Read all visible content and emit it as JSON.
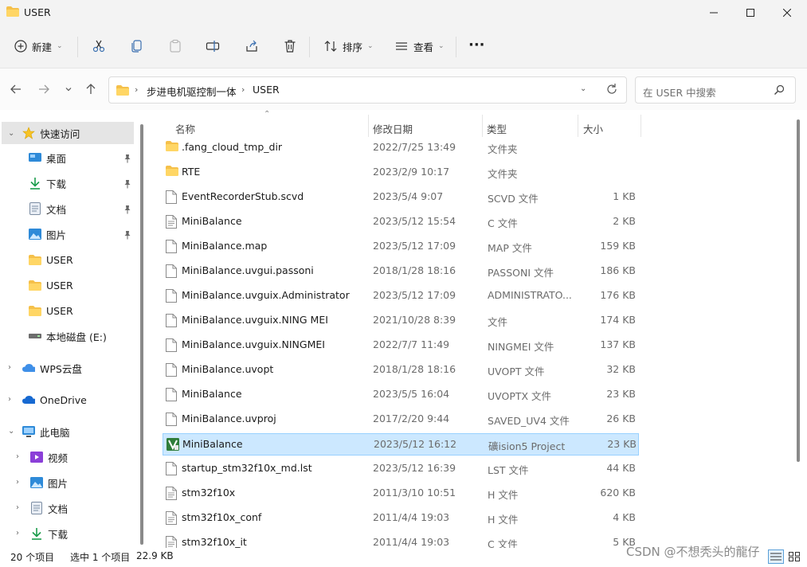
{
  "window": {
    "title": "USER"
  },
  "toolbar": {
    "new_label": "新建",
    "sort_label": "排序",
    "view_label": "查看",
    "more_label": "···"
  },
  "address": {
    "crumbs": [
      "步进电机驱控制一体",
      "USER"
    ],
    "search_placeholder": "在 USER 中搜索"
  },
  "sidebar": {
    "quick_access": "快速访问",
    "items": [
      "桌面",
      "下载",
      "文档",
      "图片",
      "USER",
      "USER",
      "USER",
      "本地磁盘 (E:)"
    ],
    "wps": "WPS云盘",
    "onedrive": "OneDrive",
    "this_pc": "此电脑",
    "pc_items": [
      "视频",
      "图片",
      "文档",
      "下载"
    ]
  },
  "columns": {
    "name": "名称",
    "date": "修改日期",
    "type": "类型",
    "size": "大小"
  },
  "files": [
    {
      "name": ".fang_cloud_tmp_dir",
      "date": "2022/7/25 13:49",
      "type": "文件夹",
      "size": "",
      "icon": "folder-icon"
    },
    {
      "name": "RTE",
      "date": "2023/2/9 10:17",
      "type": "文件夹",
      "size": "",
      "icon": "folder-icon"
    },
    {
      "name": "EventRecorderStub.scvd",
      "date": "2023/5/4 9:07",
      "type": "SCVD 文件",
      "size": "1 KB",
      "icon": "file-icon"
    },
    {
      "name": "MiniBalance",
      "date": "2023/5/12 15:54",
      "type": "C 文件",
      "size": "2 KB",
      "icon": "text-file-icon"
    },
    {
      "name": "MiniBalance.map",
      "date": "2023/5/12 17:09",
      "type": "MAP 文件",
      "size": "159 KB",
      "icon": "file-icon"
    },
    {
      "name": "MiniBalance.uvgui.passoni",
      "date": "2018/1/28 18:16",
      "type": "PASSONI 文件",
      "size": "186 KB",
      "icon": "file-icon"
    },
    {
      "name": "MiniBalance.uvguix.Administrator",
      "date": "2023/5/12 17:09",
      "type": "ADMINISTRATO...",
      "size": "176 KB",
      "icon": "file-icon"
    },
    {
      "name": "MiniBalance.uvguix.NING MEI",
      "date": "2021/10/28 8:39",
      "type": "文件",
      "size": "174 KB",
      "icon": "file-icon"
    },
    {
      "name": "MiniBalance.uvguix.NINGMEI",
      "date": "2022/7/7 11:49",
      "type": "NINGMEI 文件",
      "size": "137 KB",
      "icon": "file-icon"
    },
    {
      "name": "MiniBalance.uvopt",
      "date": "2018/1/28 18:16",
      "type": "UVOPT 文件",
      "size": "32 KB",
      "icon": "file-icon"
    },
    {
      "name": "MiniBalance",
      "date": "2023/5/5 16:04",
      "type": "UVOPTX 文件",
      "size": "23 KB",
      "icon": "file-icon"
    },
    {
      "name": "MiniBalance.uvproj",
      "date": "2017/2/20 9:44",
      "type": "SAVED_UV4 文件",
      "size": "26 KB",
      "icon": "file-icon"
    },
    {
      "name": "MiniBalance",
      "date": "2023/5/12 16:12",
      "type": "礦ision5 Project",
      "size": "23 KB",
      "icon": "keil-project-icon",
      "selected": true
    },
    {
      "name": "startup_stm32f10x_md.lst",
      "date": "2023/5/12 16:39",
      "type": "LST 文件",
      "size": "44 KB",
      "icon": "file-icon"
    },
    {
      "name": "stm32f10x",
      "date": "2011/3/10 10:51",
      "type": "H 文件",
      "size": "620 KB",
      "icon": "text-file-icon"
    },
    {
      "name": "stm32f10x_conf",
      "date": "2011/4/4 19:03",
      "type": "H 文件",
      "size": "4 KB",
      "icon": "text-file-icon"
    },
    {
      "name": "stm32f10x_it",
      "date": "2011/4/4 19:03",
      "type": "C 文件",
      "size": "5 KB",
      "icon": "text-file-icon"
    }
  ],
  "status": {
    "count": "20 个项目",
    "selection": "选中 1 个项目",
    "selection_size": "22.9 KB",
    "watermark": "CSDN @不想秃头的龍仔"
  }
}
